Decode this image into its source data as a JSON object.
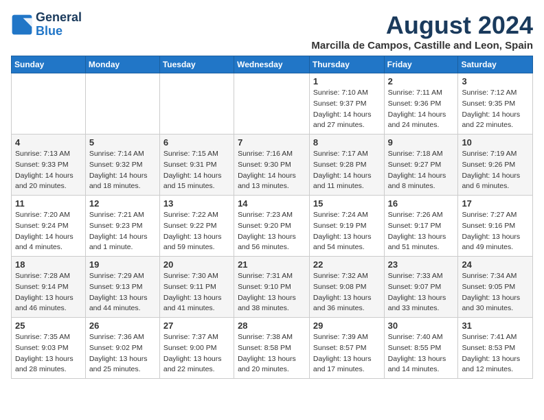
{
  "header": {
    "logo_line1": "General",
    "logo_line2": "Blue",
    "month_title": "August 2024",
    "subtitle": "Marcilla de Campos, Castille and Leon, Spain"
  },
  "days_of_week": [
    "Sunday",
    "Monday",
    "Tuesday",
    "Wednesday",
    "Thursday",
    "Friday",
    "Saturday"
  ],
  "weeks": [
    [
      {
        "day": "",
        "info": ""
      },
      {
        "day": "",
        "info": ""
      },
      {
        "day": "",
        "info": ""
      },
      {
        "day": "",
        "info": ""
      },
      {
        "day": "1",
        "info": "Sunrise: 7:10 AM\nSunset: 9:37 PM\nDaylight: 14 hours and 27 minutes."
      },
      {
        "day": "2",
        "info": "Sunrise: 7:11 AM\nSunset: 9:36 PM\nDaylight: 14 hours and 24 minutes."
      },
      {
        "day": "3",
        "info": "Sunrise: 7:12 AM\nSunset: 9:35 PM\nDaylight: 14 hours and 22 minutes."
      }
    ],
    [
      {
        "day": "4",
        "info": "Sunrise: 7:13 AM\nSunset: 9:33 PM\nDaylight: 14 hours and 20 minutes."
      },
      {
        "day": "5",
        "info": "Sunrise: 7:14 AM\nSunset: 9:32 PM\nDaylight: 14 hours and 18 minutes."
      },
      {
        "day": "6",
        "info": "Sunrise: 7:15 AM\nSunset: 9:31 PM\nDaylight: 14 hours and 15 minutes."
      },
      {
        "day": "7",
        "info": "Sunrise: 7:16 AM\nSunset: 9:30 PM\nDaylight: 14 hours and 13 minutes."
      },
      {
        "day": "8",
        "info": "Sunrise: 7:17 AM\nSunset: 9:28 PM\nDaylight: 14 hours and 11 minutes."
      },
      {
        "day": "9",
        "info": "Sunrise: 7:18 AM\nSunset: 9:27 PM\nDaylight: 14 hours and 8 minutes."
      },
      {
        "day": "10",
        "info": "Sunrise: 7:19 AM\nSunset: 9:26 PM\nDaylight: 14 hours and 6 minutes."
      }
    ],
    [
      {
        "day": "11",
        "info": "Sunrise: 7:20 AM\nSunset: 9:24 PM\nDaylight: 14 hours and 4 minutes."
      },
      {
        "day": "12",
        "info": "Sunrise: 7:21 AM\nSunset: 9:23 PM\nDaylight: 14 hours and 1 minute."
      },
      {
        "day": "13",
        "info": "Sunrise: 7:22 AM\nSunset: 9:22 PM\nDaylight: 13 hours and 59 minutes."
      },
      {
        "day": "14",
        "info": "Sunrise: 7:23 AM\nSunset: 9:20 PM\nDaylight: 13 hours and 56 minutes."
      },
      {
        "day": "15",
        "info": "Sunrise: 7:24 AM\nSunset: 9:19 PM\nDaylight: 13 hours and 54 minutes."
      },
      {
        "day": "16",
        "info": "Sunrise: 7:26 AM\nSunset: 9:17 PM\nDaylight: 13 hours and 51 minutes."
      },
      {
        "day": "17",
        "info": "Sunrise: 7:27 AM\nSunset: 9:16 PM\nDaylight: 13 hours and 49 minutes."
      }
    ],
    [
      {
        "day": "18",
        "info": "Sunrise: 7:28 AM\nSunset: 9:14 PM\nDaylight: 13 hours and 46 minutes."
      },
      {
        "day": "19",
        "info": "Sunrise: 7:29 AM\nSunset: 9:13 PM\nDaylight: 13 hours and 44 minutes."
      },
      {
        "day": "20",
        "info": "Sunrise: 7:30 AM\nSunset: 9:11 PM\nDaylight: 13 hours and 41 minutes."
      },
      {
        "day": "21",
        "info": "Sunrise: 7:31 AM\nSunset: 9:10 PM\nDaylight: 13 hours and 38 minutes."
      },
      {
        "day": "22",
        "info": "Sunrise: 7:32 AM\nSunset: 9:08 PM\nDaylight: 13 hours and 36 minutes."
      },
      {
        "day": "23",
        "info": "Sunrise: 7:33 AM\nSunset: 9:07 PM\nDaylight: 13 hours and 33 minutes."
      },
      {
        "day": "24",
        "info": "Sunrise: 7:34 AM\nSunset: 9:05 PM\nDaylight: 13 hours and 30 minutes."
      }
    ],
    [
      {
        "day": "25",
        "info": "Sunrise: 7:35 AM\nSunset: 9:03 PM\nDaylight: 13 hours and 28 minutes."
      },
      {
        "day": "26",
        "info": "Sunrise: 7:36 AM\nSunset: 9:02 PM\nDaylight: 13 hours and 25 minutes."
      },
      {
        "day": "27",
        "info": "Sunrise: 7:37 AM\nSunset: 9:00 PM\nDaylight: 13 hours and 22 minutes."
      },
      {
        "day": "28",
        "info": "Sunrise: 7:38 AM\nSunset: 8:58 PM\nDaylight: 13 hours and 20 minutes."
      },
      {
        "day": "29",
        "info": "Sunrise: 7:39 AM\nSunset: 8:57 PM\nDaylight: 13 hours and 17 minutes."
      },
      {
        "day": "30",
        "info": "Sunrise: 7:40 AM\nSunset: 8:55 PM\nDaylight: 13 hours and 14 minutes."
      },
      {
        "day": "31",
        "info": "Sunrise: 7:41 AM\nSunset: 8:53 PM\nDaylight: 13 hours and 12 minutes."
      }
    ]
  ]
}
